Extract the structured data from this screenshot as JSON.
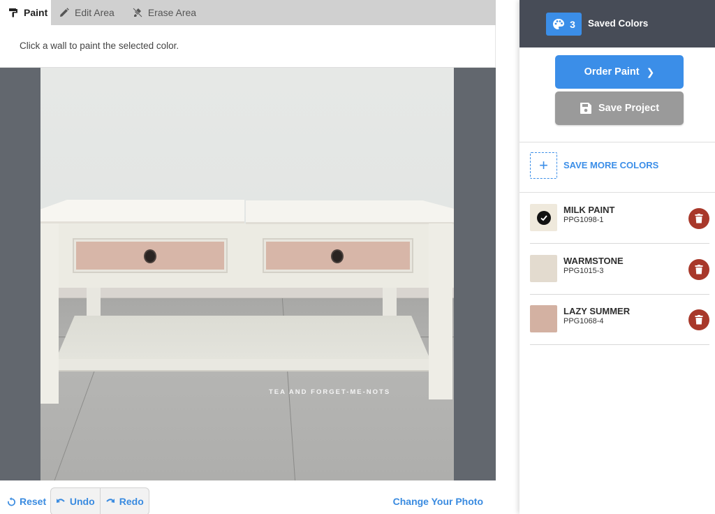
{
  "tabs": [
    {
      "label": "Paint",
      "icon": "paint-roller-icon",
      "active": true
    },
    {
      "label": "Edit Area",
      "icon": "pencil-icon",
      "active": false
    },
    {
      "label": "Erase Area",
      "icon": "eraser-icon",
      "active": false
    }
  ],
  "instruction": "Click a wall to paint the selected color.",
  "photo": {
    "watermark": "TEA AND FORGET-ME-NOTS"
  },
  "bottom_bar": {
    "reset_label": "Reset",
    "undo_label": "Undo",
    "redo_label": "Redo",
    "change_photo_label": "Change Your Photo"
  },
  "sidebar": {
    "saved_count": "3",
    "saved_title": "Saved Colors",
    "order_label": "Order Paint",
    "save_label": "Save Project",
    "add_label": "SAVE MORE COLORS",
    "colors": [
      {
        "name": "MILK PAINT",
        "code": "PPG1098-1",
        "swatch": "#efe9dc",
        "selected": true
      },
      {
        "name": "WARMSTONE",
        "code": "PPG1015-3",
        "swatch": "#e3dbcf",
        "selected": false
      },
      {
        "name": "LAZY SUMMER",
        "code": "PPG1068-4",
        "swatch": "#d3b1a2",
        "selected": false
      }
    ]
  },
  "colors": {
    "accent": "#3b8ee8",
    "header_bg": "#474c57",
    "delete": "#a8382a",
    "save_button": "#9a9a9a",
    "stage_bg": "#62676e",
    "tab_bar": "#d0d0d0"
  }
}
